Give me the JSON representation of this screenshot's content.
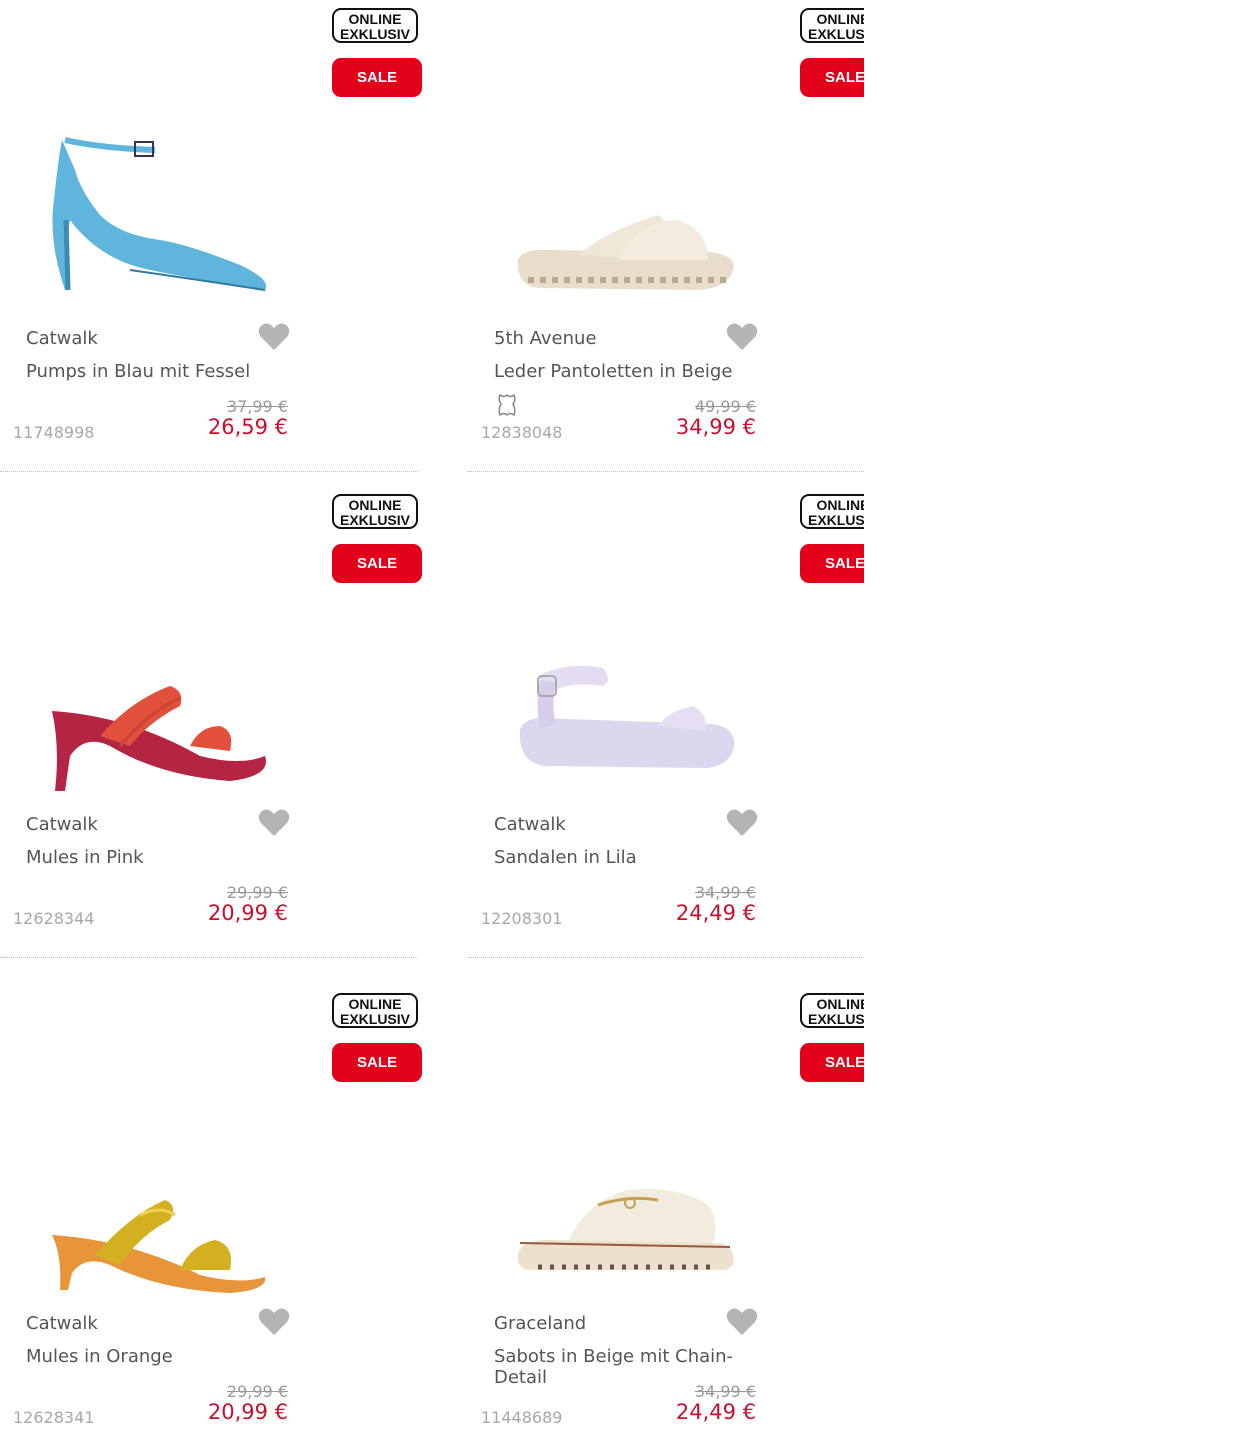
{
  "badges": {
    "online_line1": "ONLINE",
    "online_line2": "EXKLUSIV",
    "sale": "SALE"
  },
  "colors": {
    "sale_red": "#e3001b",
    "price_red": "#c8102e",
    "heart_grey": "#b4b4b4"
  },
  "products": [
    {
      "brand": "Catwalk",
      "name": "Pumps in Blau mit Fessel",
      "old_price": "37,99 €",
      "price": "26,59 €",
      "sku": "11748998",
      "leather_icon": false,
      "image": "blue-pump-icon"
    },
    {
      "brand": "5th Avenue",
      "name": "Leder Pantoletten in Beige",
      "old_price": "49,99 €",
      "price": "34,99 €",
      "sku": "12838048",
      "leather_icon": true,
      "image": "beige-slide-icon"
    },
    {
      "brand": "Catwalk",
      "name": "Mules in Pink",
      "old_price": "29,99 €",
      "price": "20,99 €",
      "sku": "12628344",
      "leather_icon": false,
      "image": "pink-mule-icon"
    },
    {
      "brand": "Catwalk",
      "name": "Sandalen in Lila",
      "old_price": "34,99 €",
      "price": "24,49 €",
      "sku": "12208301",
      "leather_icon": false,
      "image": "lilac-sandal-icon"
    },
    {
      "brand": "Catwalk",
      "name": "Mules in Orange",
      "old_price": "29,99 €",
      "price": "20,99 €",
      "sku": "12628341",
      "leather_icon": false,
      "image": "orange-mule-icon"
    },
    {
      "brand": "Graceland",
      "name": "Sabots in Beige mit Chain-Detail",
      "old_price": "34,99 €",
      "price": "24,49 €",
      "sku": "11448689",
      "leather_icon": false,
      "image": "beige-sabot-icon"
    }
  ]
}
